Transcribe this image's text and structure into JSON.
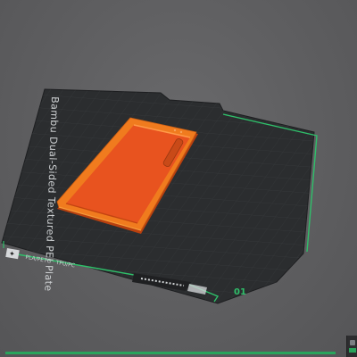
{
  "viewport": {
    "name": "3d-build-plate-view"
  },
  "plate": {
    "side_label": "Bambu Dual-Sided Textured PEI Plate",
    "bottom_badge": "✦",
    "bottom_label": "PLA/PETG · TPU/PC",
    "plate_number": "01",
    "accent_color": "#2fbf6a",
    "surface_color": "#2b2d2f"
  },
  "model": {
    "name": "phone case",
    "color": "#e8531f",
    "rim_color": "#f07b1e"
  },
  "status": {
    "progress_color": "#2aa45c"
  }
}
